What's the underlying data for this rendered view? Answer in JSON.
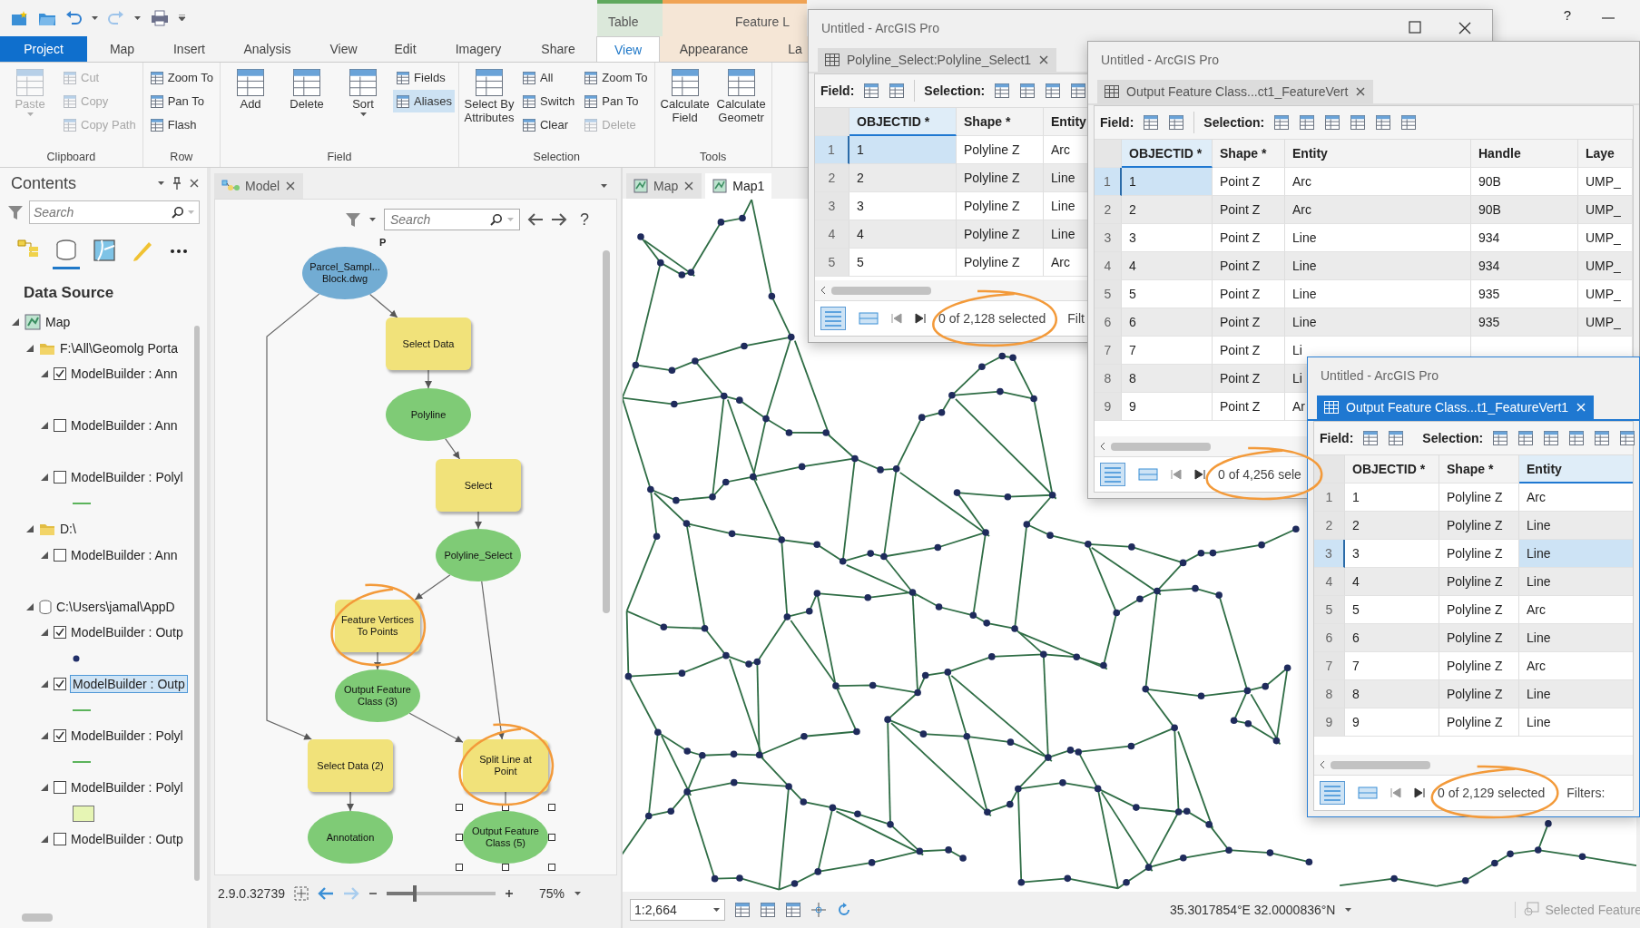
{
  "app": {
    "help": "?"
  },
  "context_tabs": [
    {
      "label": "Table",
      "kind": "table"
    },
    {
      "label": "Feature L",
      "kind": "layer"
    }
  ],
  "ribbon_tabs": [
    {
      "label": "Project",
      "kind": "backstage",
      "selected": false
    },
    {
      "label": "Map",
      "kind": "core",
      "selected": false
    },
    {
      "label": "Insert",
      "kind": "core",
      "selected": false
    },
    {
      "label": "Analysis",
      "kind": "core",
      "selected": false
    },
    {
      "label": "View",
      "kind": "core",
      "selected": false
    },
    {
      "label": "Edit",
      "kind": "core",
      "selected": false
    },
    {
      "label": "Imagery",
      "kind": "core",
      "selected": false
    },
    {
      "label": "Share",
      "kind": "core",
      "selected": false
    },
    {
      "label": "View",
      "kind": "table",
      "selected": true
    },
    {
      "label": "Appearance",
      "kind": "layer",
      "selected": false
    },
    {
      "label": "La",
      "kind": "layer",
      "selected": false
    }
  ],
  "ribbon_groups": [
    {
      "title": "Clipboard",
      "tools": [
        {
          "label": "Paste",
          "kind": "large",
          "disabled": true,
          "on": false,
          "dropdown": true
        },
        {
          "label": "Cut",
          "kind": "small",
          "disabled": true,
          "on": false,
          "dropdown": false
        },
        {
          "label": "Copy",
          "kind": "small",
          "disabled": true,
          "on": false,
          "dropdown": false
        },
        {
          "label": "Copy Path",
          "kind": "small",
          "disabled": true,
          "on": false,
          "dropdown": false
        }
      ]
    },
    {
      "title": "Row",
      "tools": [
        {
          "label": "Zoom To",
          "kind": "small",
          "disabled": false,
          "on": false,
          "dropdown": false
        },
        {
          "label": "Pan To",
          "kind": "small",
          "disabled": false,
          "on": false,
          "dropdown": false
        },
        {
          "label": "Flash",
          "kind": "small",
          "disabled": false,
          "on": false,
          "dropdown": false
        }
      ]
    },
    {
      "title": "Field",
      "tools": [
        {
          "label": "Add",
          "kind": "large",
          "disabled": false,
          "on": false,
          "dropdown": false
        },
        {
          "label": "Delete",
          "kind": "large",
          "disabled": false,
          "on": false,
          "dropdown": false
        },
        {
          "label": "Sort",
          "kind": "large",
          "disabled": false,
          "on": false,
          "dropdown": true
        },
        {
          "label": "Fields",
          "kind": "small",
          "disabled": false,
          "on": false,
          "dropdown": false
        },
        {
          "label": "Aliases",
          "kind": "small",
          "disabled": false,
          "on": true,
          "dropdown": false
        }
      ]
    },
    {
      "title": "Selection",
      "tools": [
        {
          "label": "Select By Attributes",
          "kind": "large",
          "disabled": false,
          "on": false,
          "dropdown": false
        },
        {
          "label": "All",
          "kind": "small",
          "disabled": false,
          "on": false,
          "dropdown": false
        },
        {
          "label": "Switch",
          "kind": "small",
          "disabled": false,
          "on": false,
          "dropdown": false
        },
        {
          "label": "Clear",
          "kind": "small",
          "disabled": false,
          "on": false,
          "dropdown": false
        },
        {
          "label": "Zoom To",
          "kind": "small",
          "disabled": false,
          "on": false,
          "dropdown": false
        },
        {
          "label": "Pan To",
          "kind": "small",
          "disabled": false,
          "on": false,
          "dropdown": false
        },
        {
          "label": "Delete",
          "kind": "small",
          "disabled": true,
          "on": false,
          "dropdown": false
        }
      ]
    },
    {
      "title": "Tools",
      "tools": [
        {
          "label": "Calculate Field",
          "kind": "large",
          "disabled": false,
          "on": false,
          "dropdown": false
        },
        {
          "label": "Calculate Geometr",
          "kind": "large",
          "disabled": false,
          "on": false,
          "dropdown": false
        }
      ]
    }
  ],
  "contents": {
    "title": "Contents",
    "search": {
      "placeholder": "Search"
    },
    "view_tabs": [
      {
        "kind": "drawing-order",
        "selected": false
      },
      {
        "kind": "data-source",
        "selected": true
      },
      {
        "kind": "selection",
        "selected": false
      },
      {
        "kind": "editing",
        "selected": false
      },
      {
        "kind": "more",
        "selected": false
      }
    ],
    "heading": "Data Source",
    "tree": [
      {
        "label": "Map",
        "kind": "map",
        "expanded": true,
        "children": [
          {
            "label": "F:\\All\\Geomolg Porta",
            "kind": "folder",
            "expanded": true,
            "children": [
              {
                "label": "ModelBuilder : Ann",
                "kind": "layer",
                "expanded": true,
                "checked": true,
                "selected": false,
                "legend": {
                  "kind": "annotation"
                }
              },
              {
                "label": "ModelBuilder : Ann",
                "kind": "layer",
                "expanded": true,
                "checked": false,
                "selected": false,
                "legend": {
                  "kind": "annotation"
                }
              },
              {
                "label": "ModelBuilder : Polyl",
                "kind": "layer",
                "expanded": true,
                "checked": false,
                "selected": false,
                "legend": {
                  "kind": "line"
                }
              }
            ]
          },
          {
            "label": "D:\\",
            "kind": "folder",
            "expanded": true,
            "children": [
              {
                "label": "ModelBuilder : Ann",
                "kind": "layer",
                "expanded": true,
                "checked": false,
                "selected": false,
                "legend": {
                  "kind": "annotation"
                }
              }
            ]
          },
          {
            "label": "C:\\Users\\jamal\\AppD",
            "kind": "database",
            "expanded": true,
            "children": [
              {
                "label": "ModelBuilder : Outp",
                "kind": "layer",
                "expanded": true,
                "checked": true,
                "selected": false,
                "legend": {
                  "kind": "point"
                }
              },
              {
                "label": "ModelBuilder : Outp",
                "kind": "layer",
                "expanded": true,
                "checked": true,
                "selected": true,
                "legend": {
                  "kind": "line"
                }
              },
              {
                "label": "ModelBuilder : Polyl",
                "kind": "layer",
                "expanded": true,
                "checked": true,
                "selected": false,
                "legend": {
                  "kind": "line"
                }
              },
              {
                "label": "ModelBuilder : Polyl",
                "kind": "layer",
                "expanded": true,
                "checked": false,
                "selected": false,
                "legend": {
                  "kind": "polygon"
                }
              },
              {
                "label": "ModelBuilder : Outp",
                "kind": "layer",
                "expanded": true,
                "checked": false,
                "selected": false
              }
            ]
          }
        ]
      }
    ]
  },
  "model": {
    "tab": "Model",
    "search": {
      "placeholder": "Search"
    },
    "help": "?",
    "nodes": [
      {
        "label": "Parcel_Sampl... Block.dwg",
        "kind": "input",
        "badge": "P",
        "selected": false
      },
      {
        "label": "Select Data",
        "kind": "tool",
        "selected": false
      },
      {
        "label": "Polyline",
        "kind": "data",
        "selected": false
      },
      {
        "label": "Select",
        "kind": "tool",
        "selected": false
      },
      {
        "label": "Polyline_Select",
        "kind": "data",
        "selected": false
      },
      {
        "label": "Feature Vertices To Points",
        "kind": "tool",
        "selected": false
      },
      {
        "label": "Output Feature Class (3)",
        "kind": "data",
        "selected": false
      },
      {
        "label": "Select Data (2)",
        "kind": "tool",
        "selected": false
      },
      {
        "label": "Split Line at Point",
        "kind": "tool",
        "selected": false
      },
      {
        "label": "Annotation",
        "kind": "data",
        "selected": false
      },
      {
        "label": "Output Feature Class (5)",
        "kind": "data",
        "selected": true
      }
    ],
    "version": "2.9.0.32739",
    "zoom": {
      "level": 0.26,
      "reading": "75%"
    }
  },
  "map": {
    "tabs": [
      {
        "label": "Map",
        "selected": false,
        "closable": true
      },
      {
        "label": "Map1",
        "selected": true,
        "closable": false
      }
    ],
    "scale": "1:2,664",
    "coordinates": "35.3017854°E 32.0000836°N",
    "selected_features": "Selected Feature"
  },
  "table_windows": [
    {
      "title": "Untitled - ArcGIS Pro",
      "active": false,
      "window_buttons": true,
      "tab": "Polyline_Select:Polyline_Select1",
      "field_label": "Field:",
      "selection_label": "Selection:",
      "columns": [
        {
          "label": "OBJECTID *",
          "selected": true
        },
        {
          "label": "Shape *",
          "selected": false
        },
        {
          "label": "Entity",
          "selected": false
        }
      ],
      "rows": [
        {
          "number": "1",
          "selected": true,
          "cells": [
            "1",
            "Polyline Z",
            "Arc"
          ]
        },
        {
          "number": "2",
          "selected": false,
          "cells": [
            "2",
            "Polyline Z",
            "Line"
          ]
        },
        {
          "number": "3",
          "selected": false,
          "cells": [
            "3",
            "Polyline Z",
            "Line"
          ]
        },
        {
          "number": "4",
          "selected": false,
          "cells": [
            "4",
            "Polyline Z",
            "Line"
          ]
        },
        {
          "number": "5",
          "selected": false,
          "cells": [
            "5",
            "Polyline Z",
            "Arc"
          ]
        }
      ],
      "selection_count": "0 of 2,128 selected",
      "filter_label": "Filt"
    },
    {
      "title": "Untitled - ArcGIS Pro",
      "active": false,
      "window_buttons": false,
      "tab": "Output Feature Class...ct1_FeatureVert",
      "field_label": "Field:",
      "selection_label": "Selection:",
      "columns": [
        {
          "label": "OBJECTID *",
          "selected": true
        },
        {
          "label": "Shape *",
          "selected": false
        },
        {
          "label": "Entity",
          "selected": false
        },
        {
          "label": "Handle",
          "selected": false
        },
        {
          "label": "Laye",
          "selected": false
        }
      ],
      "rows": [
        {
          "number": "1",
          "selected": true,
          "cells": [
            "1",
            "Point Z",
            "Arc",
            "90B",
            "UMP_"
          ]
        },
        {
          "number": "2",
          "selected": false,
          "cells": [
            "2",
            "Point Z",
            "Arc",
            "90B",
            "UMP_"
          ]
        },
        {
          "number": "3",
          "selected": false,
          "cells": [
            "3",
            "Point Z",
            "Line",
            "934",
            "UMP_"
          ]
        },
        {
          "number": "4",
          "selected": false,
          "cells": [
            "4",
            "Point Z",
            "Line",
            "934",
            "UMP_"
          ]
        },
        {
          "number": "5",
          "selected": false,
          "cells": [
            "5",
            "Point Z",
            "Line",
            "935",
            "UMP_"
          ]
        },
        {
          "number": "6",
          "selected": false,
          "cells": [
            "6",
            "Point Z",
            "Line",
            "935",
            "UMP_"
          ]
        },
        {
          "number": "7",
          "selected": false,
          "cells": [
            "7",
            "Point Z",
            "Li"
          ]
        },
        {
          "number": "8",
          "selected": false,
          "cells": [
            "8",
            "Point Z",
            "Li"
          ]
        },
        {
          "number": "9",
          "selected": false,
          "cells": [
            "9",
            "Point Z",
            "Ar"
          ]
        }
      ],
      "selection_count": "0 of 4,256 sele"
    },
    {
      "title": "Untitled - ArcGIS Pro",
      "active": true,
      "window_buttons": false,
      "tab": "Output Feature Class...t1_FeatureVert1",
      "field_label": "Field:",
      "selection_label": "Selection:",
      "columns": [
        {
          "label": "OBJECTID *",
          "selected": false
        },
        {
          "label": "Shape *",
          "selected": false
        },
        {
          "label": "Entity",
          "selected": true
        }
      ],
      "rows": [
        {
          "number": "1",
          "selected": false,
          "cells": [
            "1",
            "Polyline Z",
            "Arc"
          ]
        },
        {
          "number": "2",
          "selected": false,
          "cells": [
            "2",
            "Polyline Z",
            "Line"
          ]
        },
        {
          "number": "3",
          "selected": true,
          "cells": [
            "3",
            "Polyline Z",
            "Line"
          ]
        },
        {
          "number": "4",
          "selected": false,
          "cells": [
            "4",
            "Polyline Z",
            "Line"
          ]
        },
        {
          "number": "5",
          "selected": false,
          "cells": [
            "5",
            "Polyline Z",
            "Arc"
          ]
        },
        {
          "number": "6",
          "selected": false,
          "cells": [
            "6",
            "Polyline Z",
            "Line"
          ]
        },
        {
          "number": "7",
          "selected": false,
          "cells": [
            "7",
            "Polyline Z",
            "Arc"
          ]
        },
        {
          "number": "8",
          "selected": false,
          "cells": [
            "8",
            "Polyline Z",
            "Line"
          ]
        },
        {
          "number": "9",
          "selected": false,
          "cells": [
            "9",
            "Polyline Z",
            "Line"
          ]
        }
      ],
      "selection_count": "0 of 2,129 selected",
      "filter_label": "Filters:"
    }
  ]
}
